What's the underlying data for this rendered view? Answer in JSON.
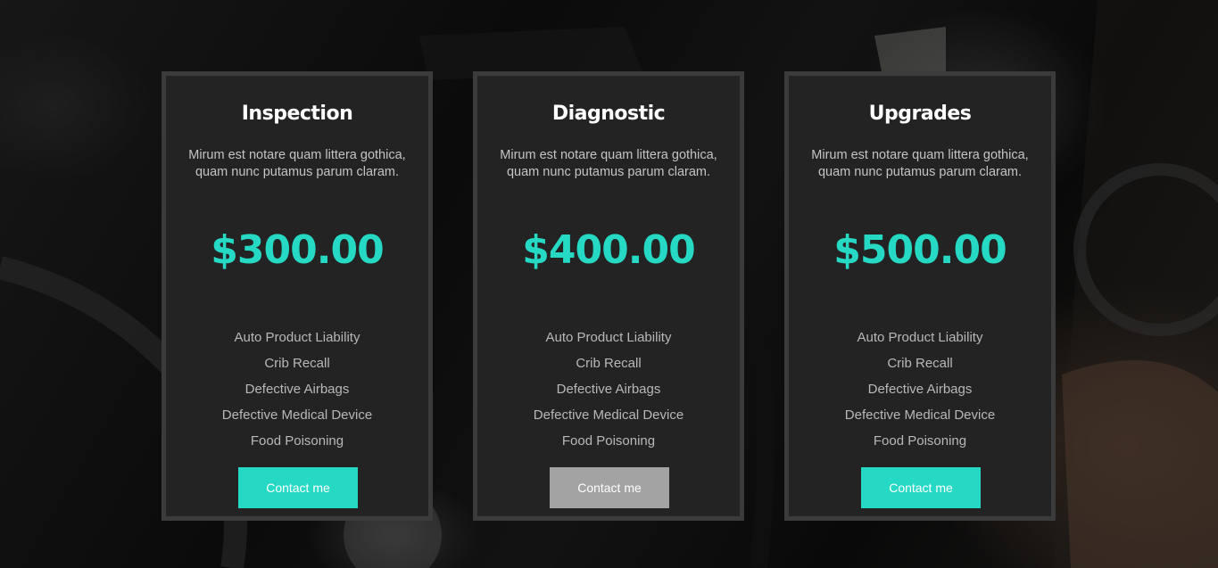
{
  "pricing": {
    "cards": [
      {
        "title": "Inspection",
        "description": "Mirum est notare quam littera gothica, quam nunc putamus parum claram.",
        "price": "$300.00",
        "features": [
          "Auto Product Liability",
          "Crib Recall",
          "Defective Airbags",
          "Defective Medical Device",
          "Food Poisoning"
        ],
        "button_label": "Contact me"
      },
      {
        "title": "Diagnostic",
        "description": "Mirum est notare quam littera gothica, quam nunc putamus parum claram.",
        "price": "$400.00",
        "features": [
          "Auto Product Liability",
          "Crib Recall",
          "Defective Airbags",
          "Defective Medical Device",
          "Food Poisoning"
        ],
        "button_label": "Contact me"
      },
      {
        "title": "Upgrades",
        "description": "Mirum est notare quam littera gothica, quam nunc putamus parum claram.",
        "price": "$500.00",
        "features": [
          "Auto Product Liability",
          "Crib Recall",
          "Defective Airbags",
          "Defective Medical Device",
          "Food Poisoning"
        ],
        "button_label": "Contact me"
      }
    ]
  },
  "colors": {
    "accent": "#26d9c4",
    "button_muted": "#a3a3a3",
    "card_background": "#232323",
    "card_border": "#3b3b3b"
  }
}
